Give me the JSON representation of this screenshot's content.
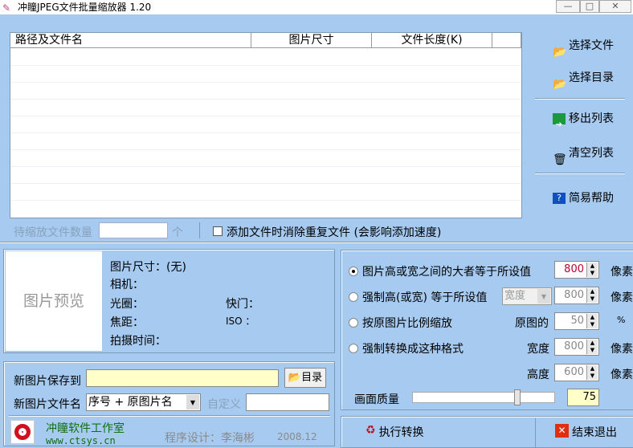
{
  "window": {
    "title": "冲瞳JPEG文件批量缩放器 1.20",
    "min": "—",
    "max": "□",
    "close": "✕"
  },
  "list": {
    "columns": [
      "路径及文件名",
      "图片尺寸",
      "文件长度(K)"
    ]
  },
  "side": {
    "select_files": "选择文件",
    "select_dir": "选择目录",
    "remove": "移出列表",
    "clear": "清空列表",
    "help": "简易帮助"
  },
  "count": {
    "label": "待缩放文件数量",
    "value": "",
    "unit": "个",
    "dedupe": "添加文件时消除重复文件 (会影响添加速度)",
    "dedupe_checked": false
  },
  "preview": {
    "placeholder": "图片预览",
    "size": "图片尺寸：(无)",
    "camera": "相机：",
    "aperture": "光圈：",
    "shutter": "快门：",
    "focal": "焦距：",
    "iso": "ISO ：",
    "time": "拍摄时间："
  },
  "options": {
    "opt1": {
      "label": "图片高或宽之间的大者等于所设值",
      "value": "800",
      "unit": "像素",
      "selected": true
    },
    "opt2": {
      "label": "强制高(或宽) 等于所设值",
      "dim": "宽度",
      "value": "800",
      "unit": "像素"
    },
    "opt3": {
      "label": "按原图片比例缩放",
      "prefix": "原图的",
      "value": "50",
      "unit": "%"
    },
    "opt4": {
      "label": "强制转换成这种格式",
      "w_label": "宽度",
      "w": "800",
      "w_unit": "像素",
      "h_label": "高度",
      "h": "600",
      "h_unit": "像素"
    },
    "quality": {
      "label": "画面质量",
      "value": "75",
      "fraction": 0.75
    }
  },
  "save": {
    "label": "新图片保存到",
    "path": "",
    "dir_btn": "目录",
    "name_label": "新图片文件名",
    "name_mode": "序号 + 原图片名",
    "custom_label": "自定义",
    "custom": ""
  },
  "footer": {
    "studio": "冲瞳软件工作室",
    "url": "www.ctsys.cn",
    "author": "程序设计：李海彬",
    "date": "2008.12"
  },
  "actions": {
    "run": "执行转换",
    "exit": "结束退出"
  }
}
